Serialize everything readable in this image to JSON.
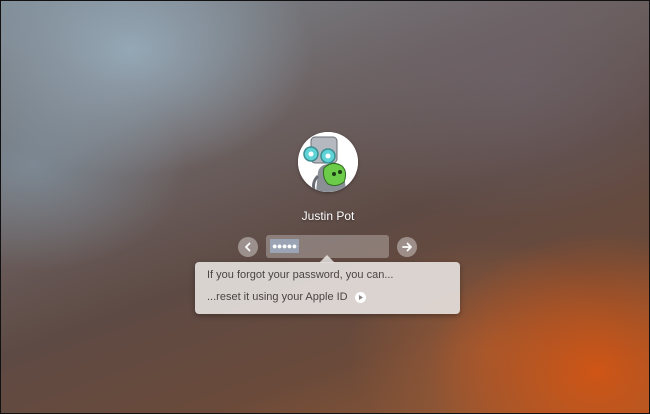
{
  "user": {
    "name": "Justin Pot",
    "avatar_icon": "robot-avatar-icon"
  },
  "password": {
    "masked_value": "●●●●●"
  },
  "navigation": {
    "back_icon": "chevron-left-icon",
    "submit_icon": "arrow-right-icon"
  },
  "hint": {
    "line1": "If you forgot your password, you can...",
    "reset_link": "...reset it using your Apple ID",
    "reset_icon": "play-circle-icon"
  },
  "colors": {
    "selection": "#9aa4b4",
    "accent_orange": "#d2551a"
  }
}
